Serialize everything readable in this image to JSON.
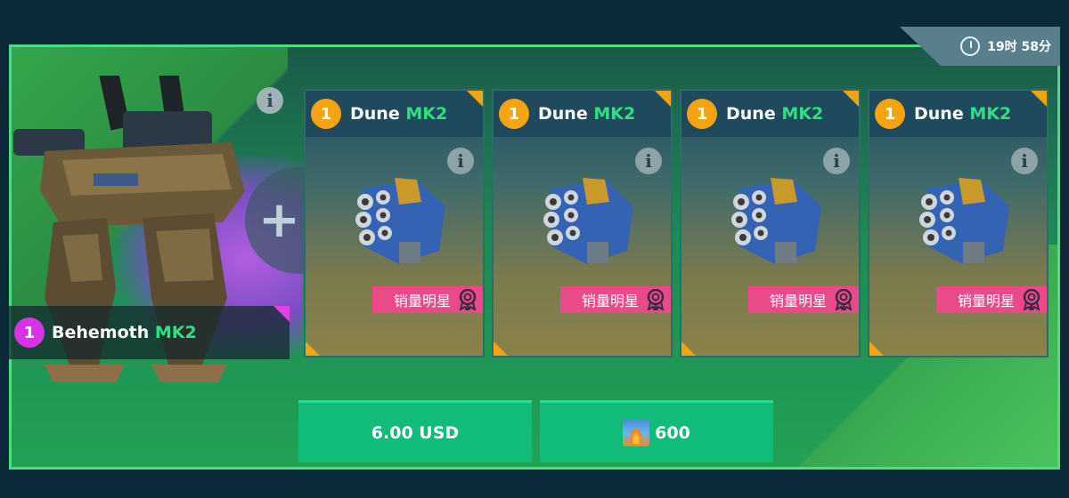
{
  "timer": {
    "text": "19时 58分"
  },
  "robot": {
    "level": "1",
    "name": "Behemoth",
    "mk": "MK2"
  },
  "cards": [
    {
      "level": "1",
      "name": "Dune",
      "mk": "MK2",
      "badge": "销量明星"
    },
    {
      "level": "1",
      "name": "Dune",
      "mk": "MK2",
      "badge": "销量明星"
    },
    {
      "level": "1",
      "name": "Dune",
      "mk": "MK2",
      "badge": "销量明星"
    },
    {
      "level": "1",
      "name": "Dune",
      "mk": "MK2",
      "badge": "销量明星"
    }
  ],
  "buttons": {
    "usd_label": "6.00 USD",
    "currency_amount": "600"
  },
  "icons": {
    "timer": "clock-icon",
    "info": "info-icon",
    "badge": "ribbon-medal-icon",
    "currency": "fire-gem-icon",
    "plus": "plus-icon"
  },
  "colors": {
    "frame": "#4fdc7c",
    "button": "#11bb7a",
    "badge": "#ea4a8a",
    "mk": "#2ee07f",
    "level_orange": "#f5a40f",
    "level_purple": "#d633e6"
  }
}
